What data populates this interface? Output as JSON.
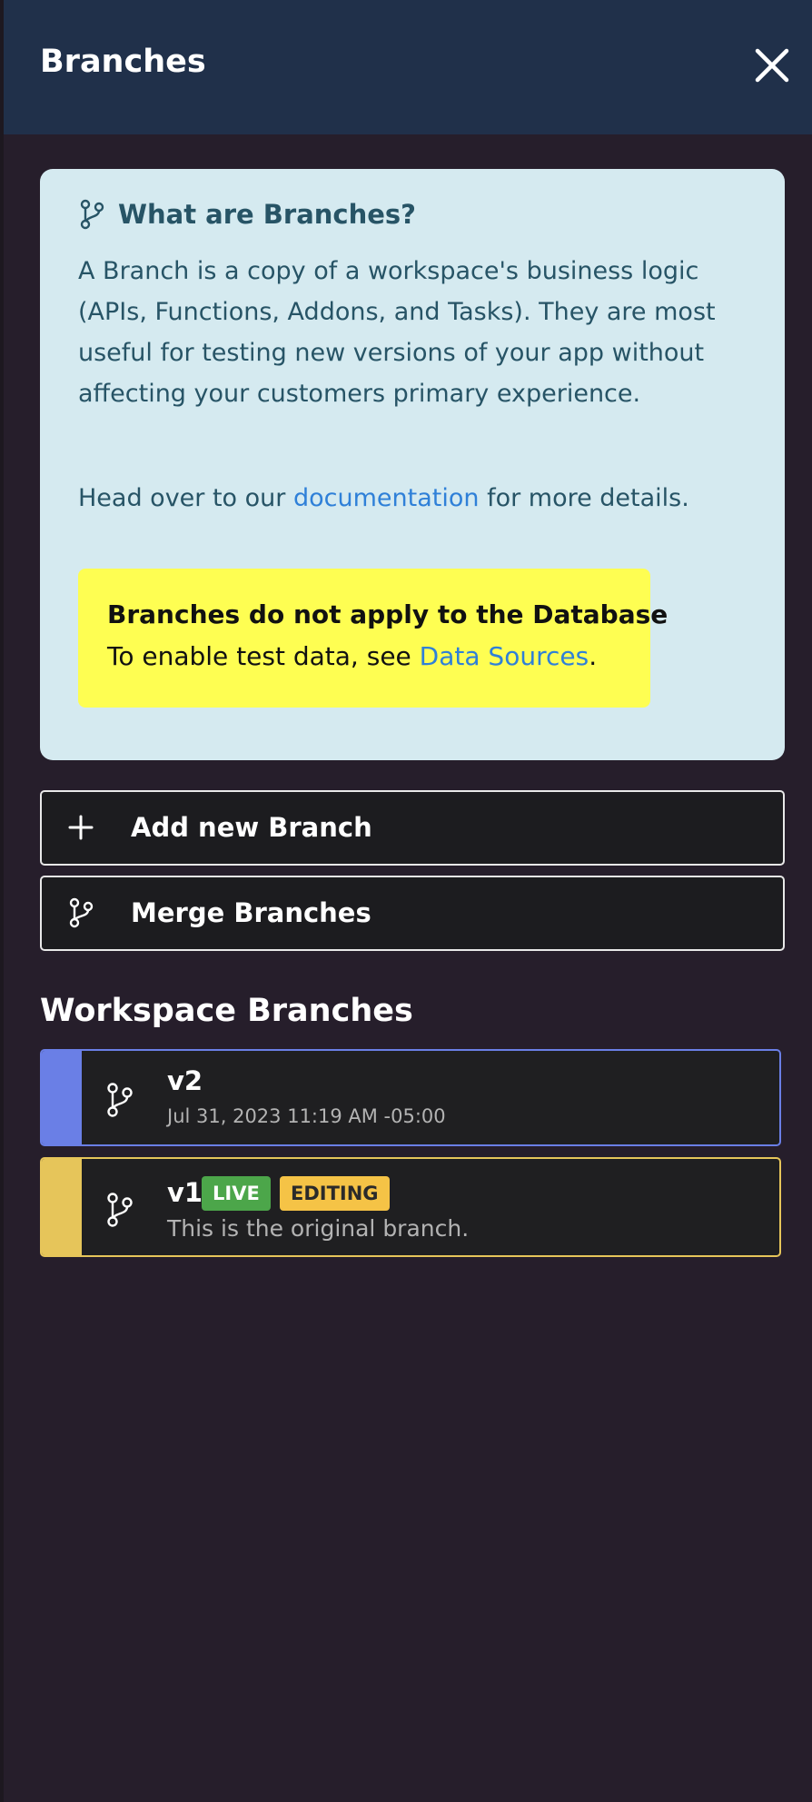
{
  "header": {
    "title": "Branches"
  },
  "info": {
    "title": "What are Branches?",
    "body": "A Branch is a copy of a workspace's business logic (APIs, Functions, Addons, and Tasks). They are most useful for testing new versions of your app without affecting your customers primary experience.",
    "doc_prefix": "Head over to our ",
    "doc_link": "documentation",
    "doc_suffix": " for more details.",
    "warning_title": "Branches do not apply to the Database",
    "warning_prefix": "To enable test data, see ",
    "warning_link": "Data Sources",
    "warning_suffix": "."
  },
  "actions": {
    "add_label": "Add new Branch",
    "merge_label": "Merge Branches"
  },
  "section": {
    "title": "Workspace Branches"
  },
  "branches": [
    {
      "name": "v2",
      "subtitle": "Jul 31, 2023 11:19 AM -05:00",
      "color": "#6a7fe6"
    },
    {
      "name": "v1",
      "subtitle": "This is the original branch.",
      "color": "#e6c55a",
      "badges": [
        "LIVE",
        "EDITING"
      ]
    }
  ],
  "colors": {
    "header_bg": "#20304a",
    "page_bg": "#261e2b",
    "info_bg": "#d5eaf0",
    "warning_bg": "#fefe52",
    "live_badge": "#4ca64a",
    "editing_badge": "#f5c346",
    "link": "#2f80d8"
  }
}
